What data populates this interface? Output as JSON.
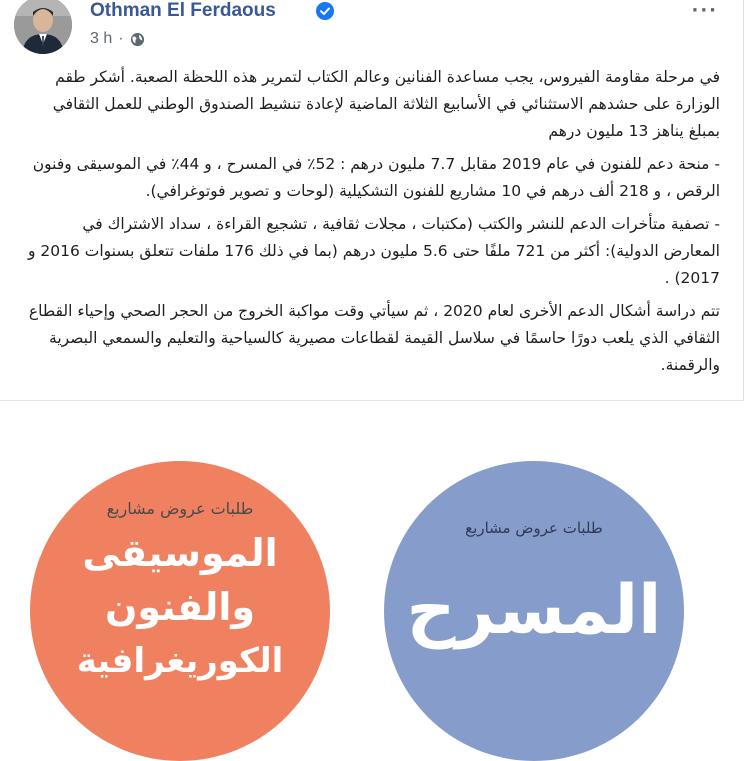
{
  "post": {
    "author": "Othman El Ferdaous",
    "time": "3 h",
    "dot": "·",
    "icons": {
      "verified": "verified-badge-icon",
      "privacy": "globe-icon",
      "more": "more-options-icon"
    },
    "more_label": "···",
    "paragraphs": [
      "في مرحلة مقاومة الفيروس، يجب مساعدة الفنانين وعالم الكتاب لتمرير هذه اللحظة الصعبة. أشكر طقم الوزارة على حشدهم الاستثنائي في الأسابيع الثلاثة الماضية لإعادة تنشيط الصندوق الوطني للعمل الثقافي بمبلغ يناهز 13 مليون درهم",
      "- منحة دعم للفنون في عام 2019 مقابل 7.7 مليون درهم : 52٪ في المسرح ، و 44٪ في الموسيقى وفنون الرقص ، و 218 ألف درهم في 10 مشاريع للفنون التشكيلية (لوحات و تصوير فوتوغرافي).",
      "- تصفية متأخرات الدعم للنشر والكتب (مكتبات ، مجلات ثقافية ، تشجيع القراءة ، سداد الاشتراك في المعارض الدولية): أكثر من 721 ملفًا حتى 5.6 مليون درهم (بما في ذلك 176 ملفات تتعلق بسنوات 2016 و 2017) .",
      "تتم دراسة أشكال الدعم الأخرى لعام 2020 ، ثم سيأتي وقت مواكبة الخروج من الحجر الصحي وإحياء القطاع الثقافي الذي يلعب دورًا حاسمًا في سلاسل القيمة لقطاعات مصيرية كالسياحية والتعليم والسمعي البصرية والرقمنة."
    ]
  },
  "images": {
    "left": {
      "subtitle": "طلبات عروض مشاريع",
      "line1": "الموسيقى",
      "line2": "والفنون",
      "line3": "الكوريغرافية",
      "color": "#f08160"
    },
    "right": {
      "subtitle": "طلبات عروض مشاريع",
      "line1": "المسرح",
      "color": "#869dcc"
    }
  },
  "colors": {
    "name": "#385898",
    "meta": "#606770",
    "text": "#1c1e21"
  }
}
